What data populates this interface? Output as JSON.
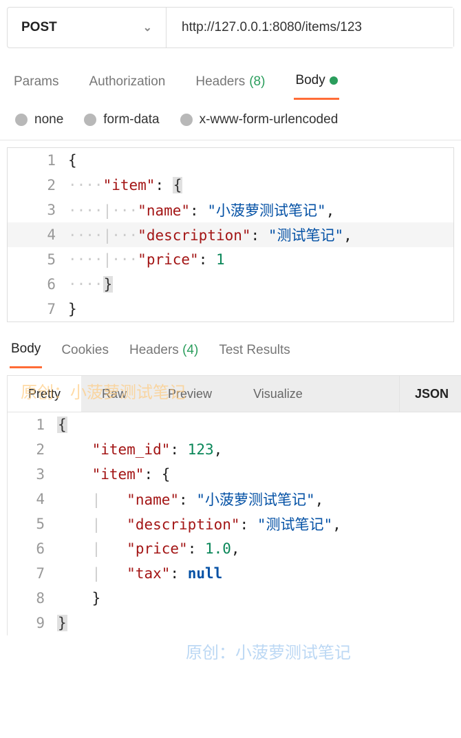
{
  "request": {
    "method": "POST",
    "url": "http://127.0.0.1:8080/items/123"
  },
  "request_tabs": {
    "params": "Params",
    "auth": "Authorization",
    "headers": "Headers",
    "headers_count": "(8)",
    "body": "Body"
  },
  "body_types": {
    "none": "none",
    "formdata": "form-data",
    "urlencoded": "x-www-form-urlencoded"
  },
  "request_body": {
    "lines": [
      "1",
      "2",
      "3",
      "4",
      "5",
      "6",
      "7"
    ],
    "key_item": "\"item\"",
    "key_name": "\"name\"",
    "val_name": "\"小菠萝测试笔记\"",
    "key_desc": "\"description\"",
    "val_desc": "\"测试笔记\"",
    "key_price": "\"price\"",
    "val_price": "1"
  },
  "response_tabs": {
    "body": "Body",
    "cookies": "Cookies",
    "headers": "Headers",
    "headers_count": "(4)",
    "test_results": "Test Results"
  },
  "view_modes": {
    "pretty": "Pretty",
    "raw": "Raw",
    "preview": "Preview",
    "visualize": "Visualize",
    "json": "JSON"
  },
  "response_body": {
    "lines": [
      "1",
      "2",
      "3",
      "4",
      "5",
      "6",
      "7",
      "8",
      "9"
    ],
    "key_item_id": "\"item_id\"",
    "val_item_id": "123",
    "key_item": "\"item\"",
    "key_name": "\"name\"",
    "val_name": "\"小菠萝测试笔记\"",
    "key_desc": "\"description\"",
    "val_desc": "\"测试笔记\"",
    "key_price": "\"price\"",
    "val_price": "1.0",
    "key_tax": "\"tax\"",
    "val_tax": "null"
  },
  "watermarks": {
    "wm1": "原创：小菠萝测试笔记",
    "wm2": "原创：小菠萝测试笔记",
    "wm3": "原创：小菠萝测试笔记"
  }
}
